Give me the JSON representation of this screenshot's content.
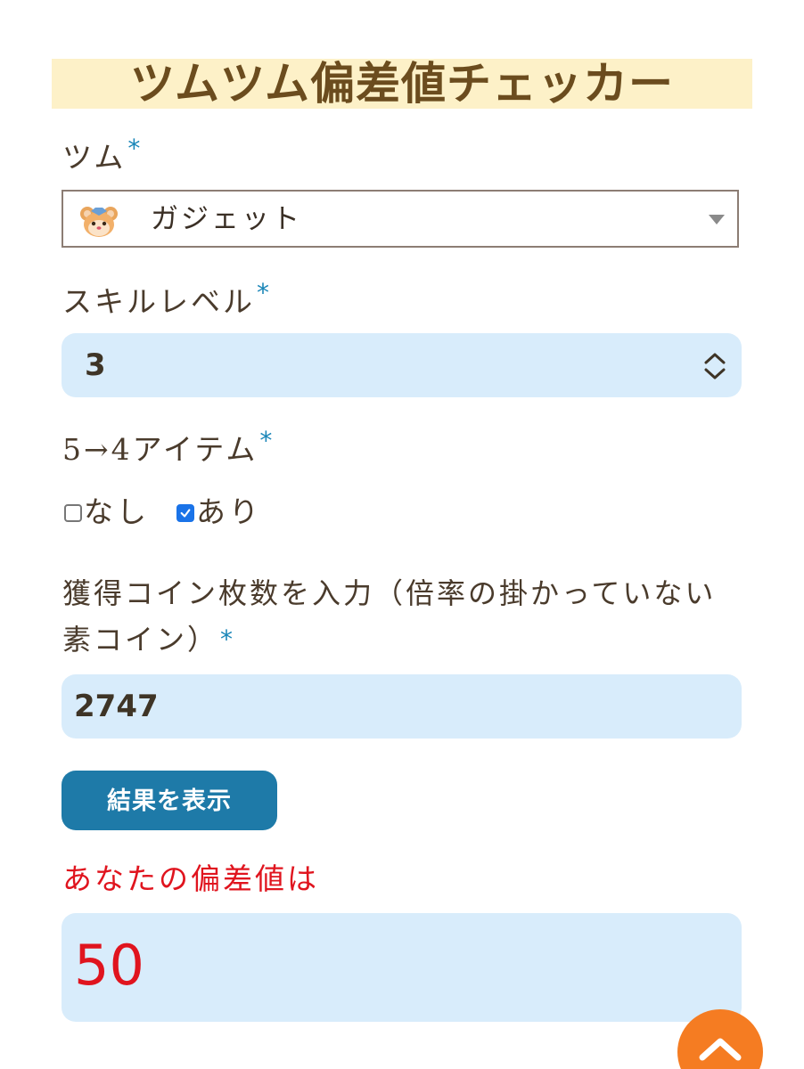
{
  "title": "ツムツム偏差値チェッカー",
  "required_mark": "*",
  "tsum": {
    "label": "ツム",
    "selected": "ガジェット",
    "avatar_icon": "gadget-tsum-avatar-icon"
  },
  "skill": {
    "label": "スキルレベル",
    "value": "3"
  },
  "item": {
    "label": "5→4アイテム",
    "options": [
      {
        "label": "なし",
        "checked": false
      },
      {
        "label": "あり",
        "checked": true
      }
    ]
  },
  "coins": {
    "label": "獲得コイン枚数を入力（倍率の掛かっていない素コイン）",
    "value": "2747"
  },
  "submit_label": "結果を表示",
  "result": {
    "label": "あなたの偏差値は",
    "value": "50"
  },
  "colors": {
    "title_band": "#fdf1c8",
    "title_text": "#6b4c1e",
    "required": "#1a86b8",
    "field_bg": "#d8ecfb",
    "button": "#1e7aa8",
    "result_text": "#e0141e",
    "scroll_top": "#f57c22"
  },
  "scroll_top_icon": "chevron-up-icon"
}
